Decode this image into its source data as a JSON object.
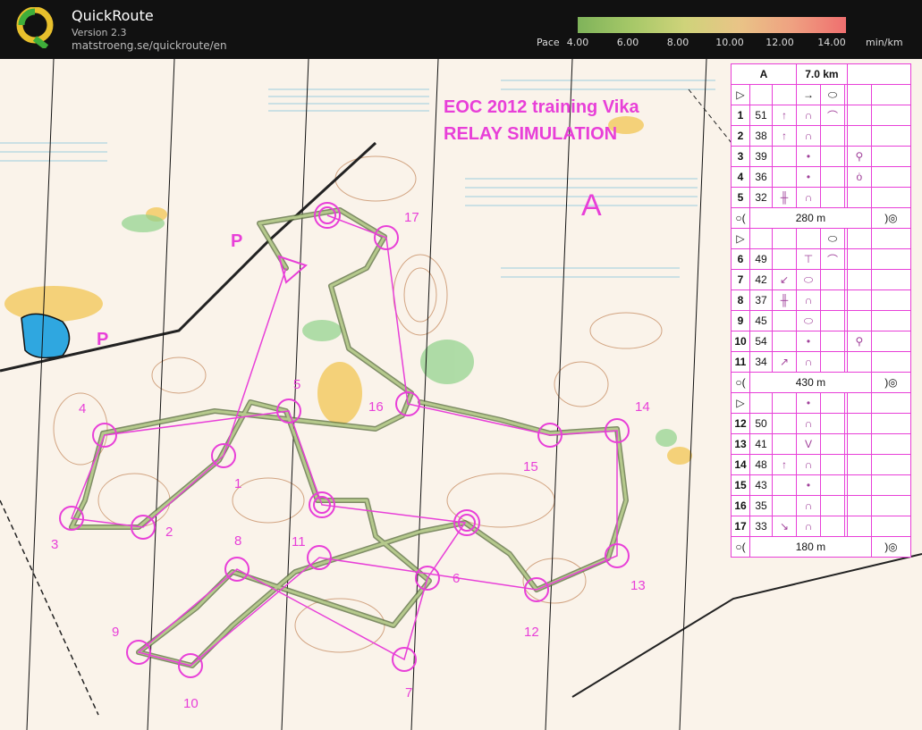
{
  "app": {
    "title": "QuickRoute",
    "version": "Version 2.3",
    "url": "matstroeng.se/quickroute/en"
  },
  "pace": {
    "label": "Pace",
    "ticks": [
      "4.00",
      "6.00",
      "8.00",
      "10.00",
      "12.00",
      "14.00"
    ],
    "unit": "min/km",
    "colors": [
      "#7fb35a",
      "#cfd37a",
      "#efa181",
      "#ef6f6f"
    ]
  },
  "map": {
    "title_line1": "EOC 2012 training Vika",
    "title_line2": "RELAY SIMULATION",
    "course_letter": "A",
    "parking_label": "P",
    "course_color": "#e83fd8",
    "route_color": "#8aa066",
    "controls": [
      "1",
      "2",
      "3",
      "4",
      "5",
      "6",
      "7",
      "8",
      "9",
      "10",
      "11",
      "12",
      "13",
      "14",
      "15",
      "16",
      "17"
    ]
  },
  "description": {
    "course": "A",
    "length": "7.0 km",
    "rows": [
      {
        "n": "1",
        "code": "51"
      },
      {
        "n": "2",
        "code": "38"
      },
      {
        "n": "3",
        "code": "39"
      },
      {
        "n": "4",
        "code": "36"
      },
      {
        "n": "5",
        "code": "32"
      },
      {
        "leg": "280 m"
      },
      {
        "n": "6",
        "code": "49"
      },
      {
        "n": "7",
        "code": "42"
      },
      {
        "n": "8",
        "code": "37"
      },
      {
        "n": "9",
        "code": "45"
      },
      {
        "n": "10",
        "code": "54"
      },
      {
        "n": "11",
        "code": "34"
      },
      {
        "leg": "430 m"
      },
      {
        "n": "12",
        "code": "50"
      },
      {
        "n": "13",
        "code": "41"
      },
      {
        "n": "14",
        "code": "48"
      },
      {
        "n": "15",
        "code": "43"
      },
      {
        "n": "16",
        "code": "35"
      },
      {
        "n": "17",
        "code": "33"
      },
      {
        "leg": "180 m"
      }
    ]
  }
}
